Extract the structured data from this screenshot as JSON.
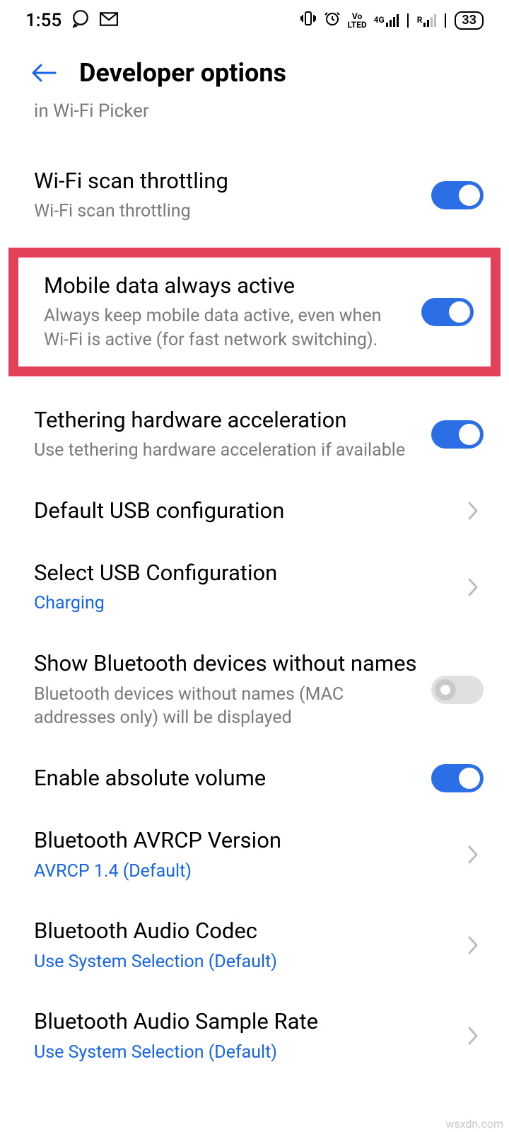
{
  "status": {
    "time": "1:55",
    "volte": "Vo\nLTE",
    "net4g": "4G",
    "roam": "R",
    "battery": "33"
  },
  "header": {
    "title": "Developer options"
  },
  "cutoff_text": "in Wi-Fi Picker",
  "items": {
    "wifi_throttle": {
      "title": "Wi-Fi scan throttling",
      "subtitle": "Wi-Fi scan throttling"
    },
    "mobile_data": {
      "title": "Mobile data always active",
      "subtitle": "Always keep mobile data active, even when Wi-Fi is active (for fast network switching)."
    },
    "tethering": {
      "title": "Tethering hardware acceleration",
      "subtitle": "Use tethering hardware acceleration if available"
    },
    "default_usb": {
      "title": "Default USB configuration"
    },
    "select_usb": {
      "title": "Select USB Configuration",
      "value": "Charging"
    },
    "bt_noname": {
      "title": "Show Bluetooth devices without names",
      "subtitle": "Bluetooth devices without names (MAC addresses only) will be displayed"
    },
    "abs_vol": {
      "title": "Enable absolute volume"
    },
    "avrcp": {
      "title": "Bluetooth AVRCP Version",
      "value": "AVRCP 1.4 (Default)"
    },
    "codec": {
      "title": "Bluetooth Audio Codec",
      "value": "Use System Selection (Default)"
    },
    "sample_rate": {
      "title": "Bluetooth Audio Sample Rate",
      "value": "Use System Selection (Default)"
    }
  },
  "watermark": "wsxdn.com"
}
